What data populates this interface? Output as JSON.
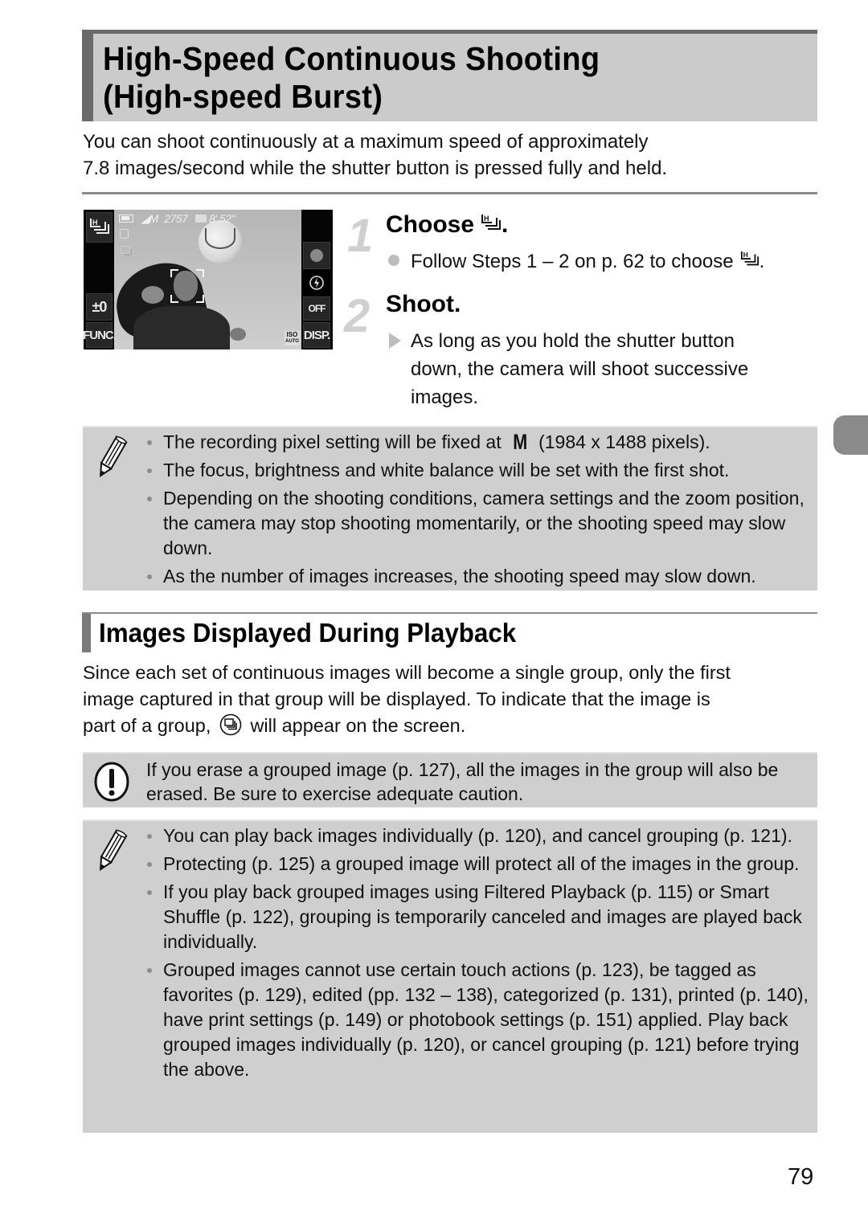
{
  "page": {
    "title_line1": "High-Speed Continuous Shooting",
    "title_line2": "(High-speed Burst)",
    "intro_line1": "You can shoot continuously at a maximum speed of approximately",
    "intro_line2": "7.8 images/second while the shutter button is pressed fully and held.",
    "page_number": "79"
  },
  "camera_screen": {
    "mode_icon": "high-speed-burst-icon",
    "battery_icon": "battery-icon",
    "resolution_label": "M",
    "shots_remaining": "2757",
    "movie_time": "8' 52\"",
    "left_buttons": [
      "±0",
      "FUNC."
    ],
    "right_buttons": [
      "record-dot",
      "flash-off",
      "OFF",
      "DISP."
    ],
    "iso_label": "ISO",
    "iso_value": "AUTO"
  },
  "steps": [
    {
      "number": "1",
      "title": "Choose",
      "title_icon": "high-speed-burst-icon",
      "title_suffix": ".",
      "bullet_type": "circle",
      "lines": [
        "Follow Steps 1 – 2 on p. 62 to choose"
      ],
      "line_suffix": "."
    },
    {
      "number": "2",
      "title": "Shoot.",
      "bullet_type": "triangle",
      "lines": [
        "As long as you hold the shutter button",
        "down, the camera will shoot successive",
        "images."
      ]
    }
  ],
  "note1": {
    "icon": "pencil-icon",
    "items": [
      {
        "pre": "The recording pixel setting will be fixed at",
        "mark": "M",
        "post": "(1984 x 1488 pixels)."
      },
      {
        "text": "The focus, brightness and white balance will be set with the first shot."
      },
      {
        "text": "Depending on the shooting conditions, camera settings and the zoom position, the camera may stop shooting momentarily, or the shooting speed may slow down."
      },
      {
        "text": "As the number of images increases, the shooting speed may slow down."
      }
    ]
  },
  "section2": {
    "heading": "Images Displayed During Playback",
    "para_line1": "Since each set of continuous images will become a single group, only the first",
    "para_line2": "image captured in that group will be displayed. To indicate that the image is",
    "para_line3_pre": "part of a group,",
    "para_line3_icon": "group-playback-icon",
    "para_line3_post": "will appear on the screen."
  },
  "caution": {
    "icon": "caution-icon",
    "text": "If you erase a grouped image (p. 127), all the images in the group will also be erased. Be sure to exercise adequate caution."
  },
  "note2": {
    "icon": "pencil-icon",
    "items": [
      "You can play back images individually (p. 120), and cancel grouping (p. 121).",
      "Protecting (p. 125) a grouped image will protect all of the images in the group.",
      "If you play back grouped images using Filtered Playback (p. 115) or Smart Shuffle (p. 122), grouping is temporarily canceled and images are played back individually.",
      "Grouped images cannot use certain touch actions (p. 123), be tagged as favorites (p. 129), edited (pp. 132 – 138), categorized (p. 131), printed (p. 140), have print settings (p. 149) or photobook settings (p. 151) applied. Play back grouped images individually (p. 120), or cancel grouping (p. 121) before trying the above."
    ]
  }
}
